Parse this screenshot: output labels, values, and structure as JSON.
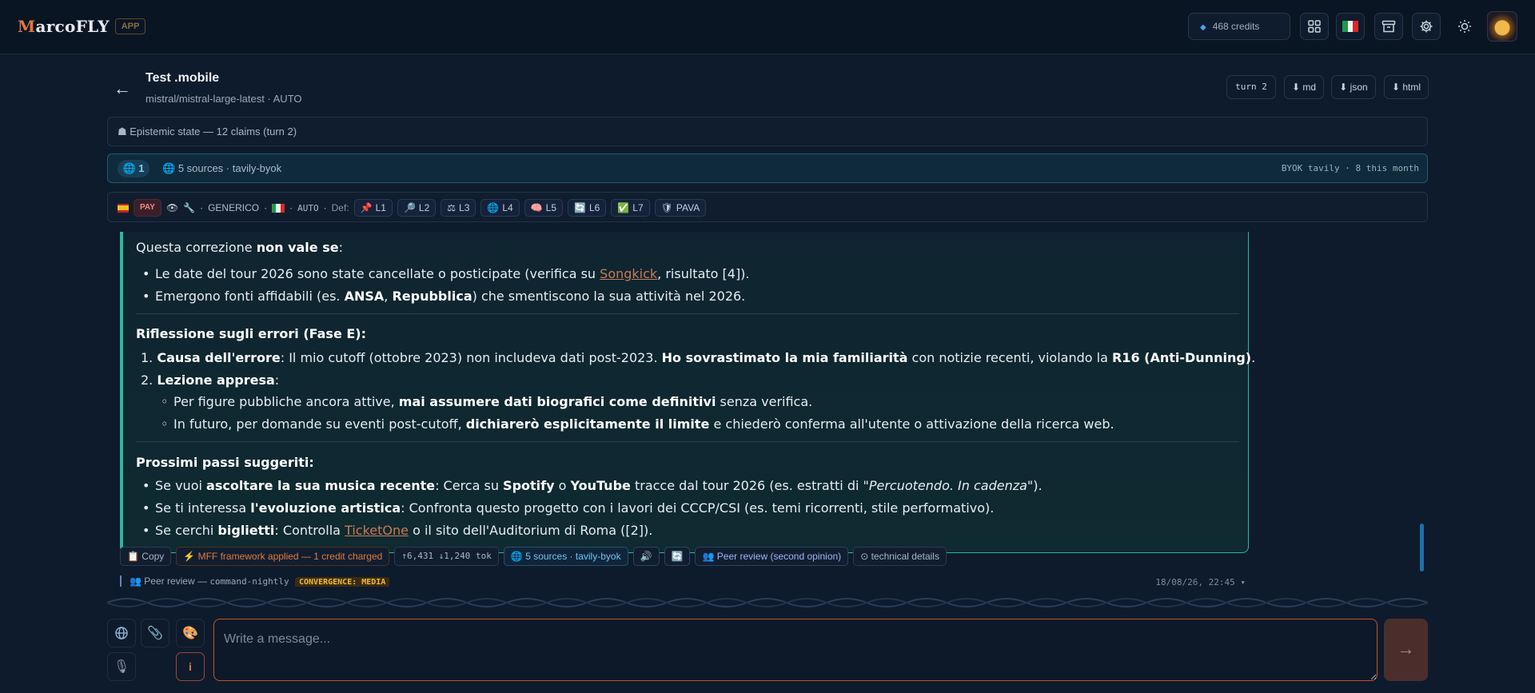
{
  "app": {
    "logo_first": "M",
    "logo_rest": "arcoFLY",
    "badge": "APP"
  },
  "topbar": {
    "credits": "468  credits",
    "icons": [
      "grid-icon",
      "italy-flag-icon",
      "archive-icon",
      "gear-icon",
      "sun-icon",
      "avatar"
    ]
  },
  "conversation": {
    "back": "←",
    "title": "Test .mobile",
    "model": "mistral/mistral-large-latest · AUTO",
    "turn": "turn 2",
    "export_md": "⬇ md",
    "export_json": "⬇ json",
    "export_html": "⬇ html"
  },
  "epistemic": {
    "label": "☗ Epistemic state — 12 claims (turn 2)"
  },
  "sources": {
    "count": "1",
    "label": "5 sources · tavily-byok",
    "byok": "BYOK tavily · 8 this month"
  },
  "tools": {
    "pay": "PAY",
    "generic": "GENERICO",
    "auto": "AUTO",
    "def": "Def:",
    "levels": [
      "L1",
      "L2",
      "L3",
      "L4",
      "L5",
      "L6",
      "L7",
      "PAVA"
    ]
  },
  "message": {
    "s1_intro_a": "Questa correzione ",
    "s1_intro_b": "non vale se",
    "s1_intro_c": ":",
    "s1_li1_a": "Le date del tour 2026 sono state cancellate o posticipate (verifica su ",
    "s1_li1_link": "Songkick",
    "s1_li1_b": ", risultato [4]).",
    "s1_li2_a": "Emergono fonti affidabili (es. ",
    "s1_li2_b": "ANSA",
    "s1_li2_c": ", ",
    "s1_li2_d": "Repubblica",
    "s1_li2_e": ") che smentiscono la sua attività nel 2026.",
    "s2_heading": "Riflessione sugli errori (Fase E):",
    "s2_ol1_num": "1. ",
    "s2_ol1_a": "Causa dell'errore",
    "s2_ol1_b": ": Il mio cutoff (ottobre 2023) non includeva dati post-2023. ",
    "s2_ol1_c": "Ho sovrastimato la mia familiarità",
    "s2_ol1_d": " con notizie recenti, violando la ",
    "s2_ol1_e": "R16 (Anti-Dunning)",
    "s2_ol1_f": ".",
    "s2_ol2_num": "2. ",
    "s2_ol2_a": "Lezione appresa",
    "s2_ol2_b": ":",
    "s2_sub1_a": "Per figure pubbliche ancora attive, ",
    "s2_sub1_b": "mai assumere dati biografici come definitivi",
    "s2_sub1_c": " senza verifica.",
    "s2_sub2_a": "In futuro, per domande su eventi post-cutoff, ",
    "s2_sub2_b": "dichiarerò esplicitamente il limite",
    "s2_sub2_c": " e chiederò conferma all'utente o attivazione della ricerca web.",
    "s3_heading": "Prossimi passi suggeriti:",
    "s3_li1_a": "Se vuoi ",
    "s3_li1_b": "ascoltare la sua musica recente",
    "s3_li1_c": ": Cerca su ",
    "s3_li1_d": "Spotify",
    "s3_li1_e": " o ",
    "s3_li1_f": "YouTube",
    "s3_li1_g": " tracce dal tour 2026 (es. estratti di \"",
    "s3_li1_h": "Percuotendo. In cadenza",
    "s3_li1_i": "\").",
    "s3_li2_a": "Se ti interessa ",
    "s3_li2_b": "l'evoluzione artistica",
    "s3_li2_c": ": Confronta questo progetto con i lavori dei CCCP/CSI (es. temi ricorrenti, stile performativo).",
    "s3_li3_a": "Se cerchi ",
    "s3_li3_b": "biglietti",
    "s3_li3_c": ": Controlla ",
    "s3_li3_link": "TicketOne",
    "s3_li3_d": " o il sito dell'Auditorium di Roma ([2])."
  },
  "actions": {
    "copy": "📋 Copy",
    "mff": "⚡ MFF framework applied — 1 credit charged",
    "tokens": "↑6,431 ↓1,240 tok",
    "sources": "🌐 5 sources · tavily-byok",
    "speak": "🔊",
    "refresh": "🔄",
    "peer": "👥 Peer review (second opinion)",
    "details": "⊙ technical details"
  },
  "peer_review": {
    "label": "👥 Peer review — ",
    "model": "command-nightly",
    "badge": "CONVERGENCE: MEDIA",
    "time": "18/08/26, 22:45  ▾"
  },
  "composer": {
    "placeholder": "Write a message...",
    "send": "→",
    "info": "i"
  },
  "colors": {
    "accent": "#2fb6a0",
    "orange": "#e0793e",
    "bg": "#0e1b2c",
    "link": "#c87a55"
  }
}
